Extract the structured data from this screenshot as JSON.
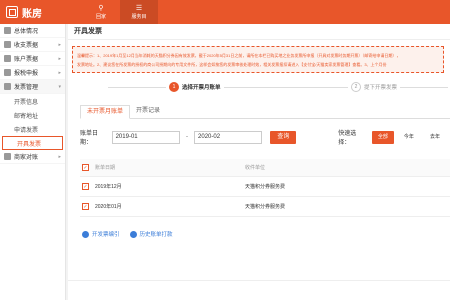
{
  "app": {
    "logo": "账房"
  },
  "topnav": [
    {
      "label": "回家",
      "icon": "person-icon",
      "glyph": "⚲"
    },
    {
      "label": "服务目",
      "icon": "list-icon",
      "glyph": "☰"
    }
  ],
  "sidebar": {
    "items": [
      {
        "label": "总体情况",
        "icon": "home-icon"
      },
      {
        "label": "收支票据",
        "icon": "receipt-icon",
        "arrow": "▸"
      },
      {
        "label": "账户票据",
        "icon": "account-icon",
        "arrow": "▸"
      },
      {
        "label": "报税申报",
        "icon": "tax-icon",
        "arrow": "▸"
      },
      {
        "label": "发票管理",
        "icon": "invoice-icon",
        "arrow": "▾"
      }
    ],
    "subitems": [
      {
        "label": "开票信息"
      },
      {
        "label": "邮寄地址"
      },
      {
        "label": "申请发票"
      },
      {
        "label": "开具发票"
      }
    ],
    "after": {
      "label": "商家对账",
      "icon": "shop-icon",
      "arrow": "▸"
    }
  },
  "page": {
    "title": "开具发票"
  },
  "notice": {
    "line1": "温馨提示：1、2019年1月至12月当年消耗的天猫积分券因有效发票，截于2020年5月31日之前，请所在本栏已购买地之业务发票所申报（开具对发票时务期开票）（邮寄给申请日期），",
    "line2": "发票地址。2、建议您在所发票的授权的商公司授期向的专用文件所，这样会如按您的发票审核处理时效，相关发票报扣请进入【支付宝/天猫卖家发票管理】查看。3、上个月份"
  },
  "steps": [
    {
      "num": "1",
      "label": "选择开票月账单"
    },
    {
      "num": "2",
      "label": "提下开票发票"
    }
  ],
  "tabs": [
    {
      "label": "未开票月账单"
    },
    {
      "label": "开票记录"
    }
  ],
  "filter": {
    "label": "账单日期：",
    "from": "2019-01",
    "sep": "-",
    "to": "2020-02",
    "query": "查询",
    "quick_label": "快速选择：",
    "quick": [
      {
        "label": "全部"
      },
      {
        "label": "今年"
      },
      {
        "label": "去年"
      }
    ]
  },
  "table": {
    "headers": [
      "账单日期",
      "收件单位"
    ],
    "rows": [
      {
        "date": "2019年12月",
        "unit": "天猫积分券服务费"
      },
      {
        "date": "2020年01月",
        "unit": "天猫积分券服务费"
      }
    ]
  },
  "actions": [
    {
      "label": "开发票编引"
    },
    {
      "label": "历史账单打款"
    }
  ],
  "colors": {
    "accent": "#e8562a",
    "link": "#3b7dd8"
  }
}
